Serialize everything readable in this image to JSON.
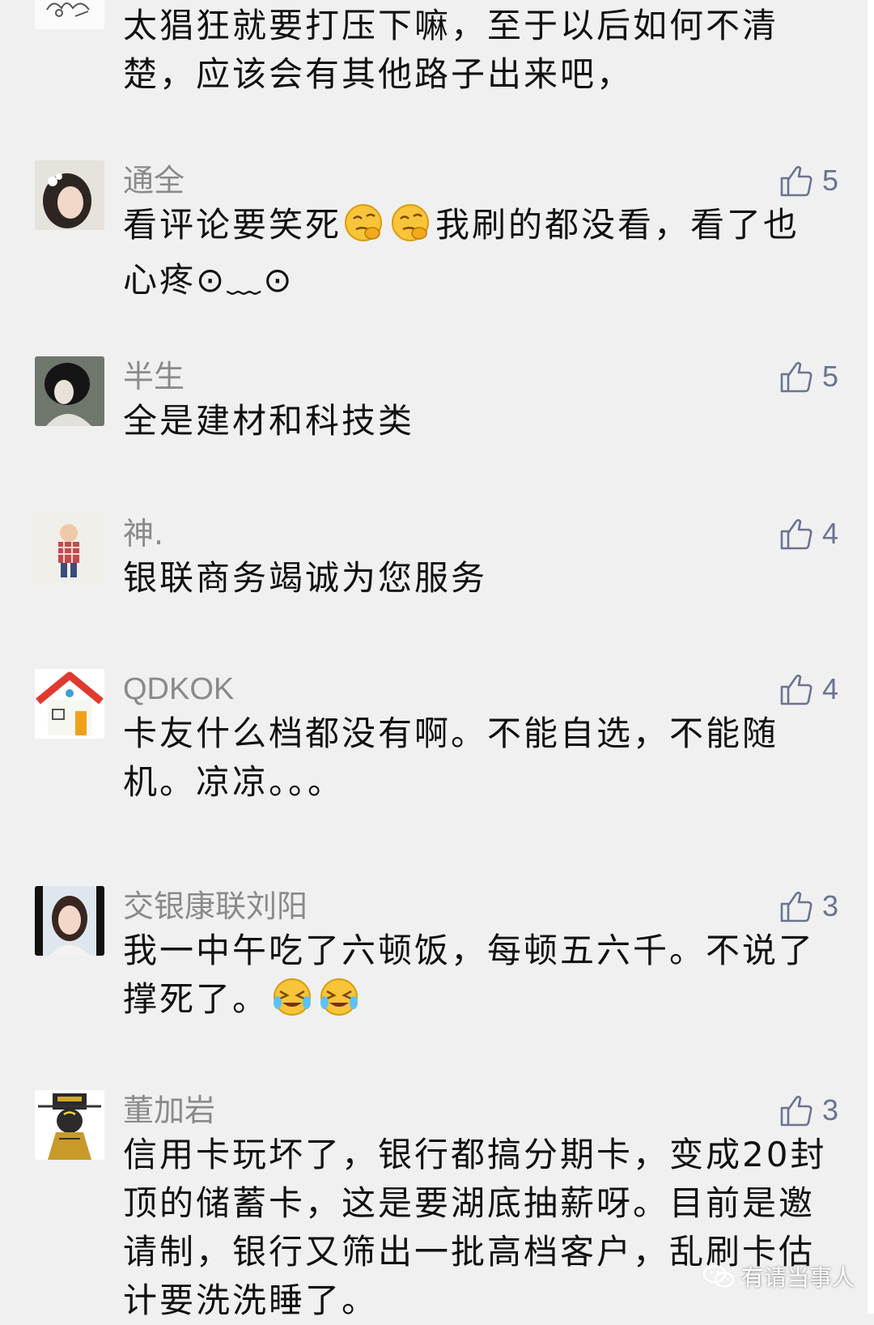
{
  "comments": [
    {
      "avatar": "cartoon-avatar",
      "name": "",
      "text": "太猖狂就要打压下嘛，至于以后如何不清楚，应该会有其他路子出来吧，",
      "likes": ""
    },
    {
      "avatar": "girl-portrait-avatar",
      "name": "通全",
      "text_a": "看评论要笑死",
      "text_b": "我刷的都没看，看了也心疼⊙﹏⊙",
      "likes": "5"
    },
    {
      "avatar": "dark-portrait-avatar",
      "name": "半生",
      "text": "全是建材和科技类",
      "likes": "5"
    },
    {
      "avatar": "child-photo-avatar",
      "name": "神.",
      "text": "银联商务竭诚为您服务",
      "likes": "4"
    },
    {
      "avatar": "house-icon-avatar",
      "name": "QDKOK",
      "text": "卡友什么档都没有啊。不能自选，不能随机。凉凉。。。",
      "likes": "4"
    },
    {
      "avatar": "woman-photo-avatar",
      "name": "交银康联刘阳",
      "text_a": "我一中午吃了六顿饭，每顿五六千。不说了撑死了。",
      "likes": "3"
    },
    {
      "avatar": "judge-bao-avatar",
      "name": "董加岩",
      "text": "信用卡玩坏了，银行都搞分期卡，变成20封顶的储蓄卡，这是要湖底抽薪呀。目前是邀请制，银行又筛出一批高档客户，乱刷卡估计要洗洗睡了。",
      "likes": "3"
    }
  ],
  "watermark": {
    "text": "有请当事人",
    "icon": "wechat-icon"
  },
  "colors": {
    "background": "#f0f0f0",
    "name": "#8a8a8a",
    "text": "#111111",
    "like": "#6b7392"
  }
}
